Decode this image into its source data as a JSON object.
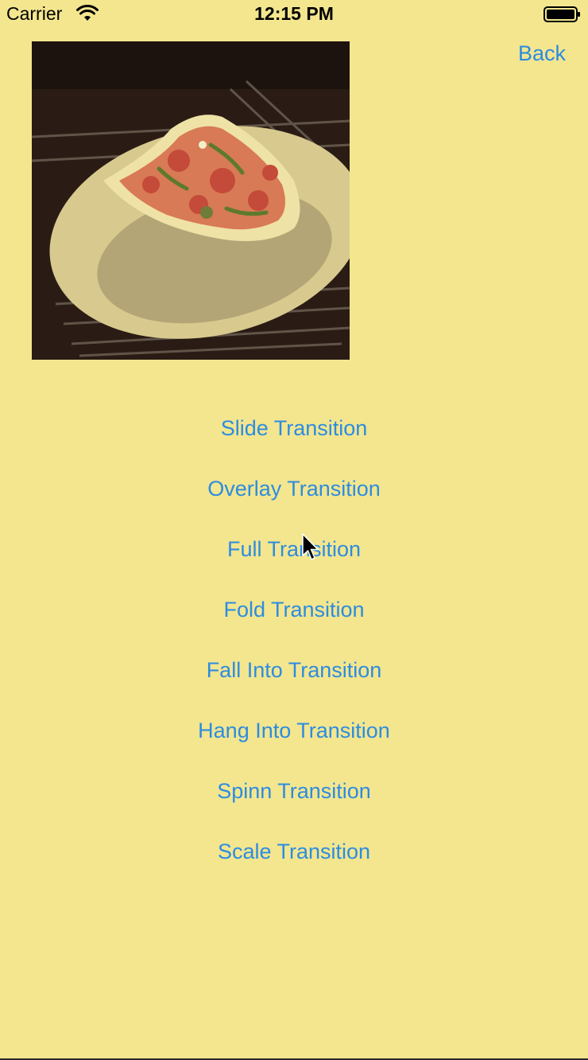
{
  "status_bar": {
    "carrier": "Carrier",
    "time": "12:15 PM"
  },
  "nav": {
    "back_label": "Back"
  },
  "photo": {
    "icon": "pizza-photo"
  },
  "transitions": [
    {
      "label": "Slide Transition"
    },
    {
      "label": "Overlay Transition"
    },
    {
      "label": "Full Transition"
    },
    {
      "label": "Fold Transition"
    },
    {
      "label": "Fall Into Transition"
    },
    {
      "label": "Hang Into Transition"
    },
    {
      "label": "Spinn Transition"
    },
    {
      "label": "Scale Transition"
    }
  ],
  "colors": {
    "background": "#f3e68f",
    "accent": "#2d8ce0"
  }
}
